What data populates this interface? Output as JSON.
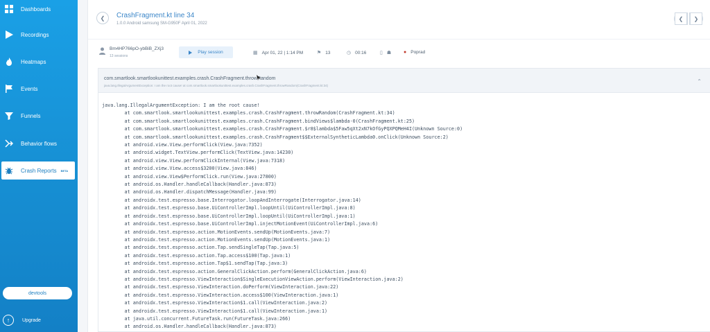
{
  "sidebar": {
    "items": [
      {
        "label": "Dashboards",
        "icon": "dashboards-icon"
      },
      {
        "label": "Recordings",
        "icon": "play-icon"
      },
      {
        "label": "Heatmaps",
        "icon": "flame-icon"
      },
      {
        "label": "Events",
        "icon": "flag-icon"
      },
      {
        "label": "Funnels",
        "icon": "funnel-icon"
      },
      {
        "label": "Behavior flows",
        "icon": "flows-icon"
      },
      {
        "label": "Crash Reports",
        "icon": "bug-icon",
        "active": true,
        "badge": "BETA"
      }
    ],
    "devtools_label": "devtools",
    "upgrade_label": "Upgrade"
  },
  "header": {
    "title": "CrashFragment.kt line 34",
    "subtitle": "1.0.0 Android samsung SM-G950F April 01, 2022"
  },
  "session": {
    "user_id": "Bm4HP766pO-ybBiB_ZXj3",
    "sessions": "13 sessions",
    "play_label": "Play session",
    "datetime": "Apr 01, 22 | 1:14 PM",
    "events": "13",
    "duration": "00:16",
    "location": "Poprad"
  },
  "crash": {
    "name": "com.smartlook.smartlookunittest.examples.crash.CrashFragment.throwRandom",
    "message": "java.lang.IllegalArgumentException: I am the root cause! at com.smartlook.smartlookunittest.examples.crash.CrashFragment.throwRandom(CrashFragment.kt:34)",
    "stacktrace": "java.lang.IllegalArgumentException: I am the root cause!\n        at com.smartlook.smartlookunittest.examples.crash.CrashFragment.throwRandom(CrashFragment.kt:34)\n        at com.smartlook.smartlookunittest.examples.crash.CrashFragment.bindViews$lambda-0(CrashFragment.kt:25)\n        at com.smartlook.smartlookunittest.examples.crash.CrashFragment.$r8$lambda$5Faw5qXt2xN7kOfGyPQXPQMeH4I(Unknown Source:0)\n        at com.smartlook.smartlookunittest.examples.crash.CrashFragment$$ExternalSyntheticLambda0.onClick(Unknown Source:2)\n        at android.view.View.performClick(View.java:7352)\n        at android.widget.TextView.performClick(TextView.java:14230)\n        at android.view.View.performClickInternal(View.java:7318)\n        at android.view.View.access$3200(View.java:846)\n        at android.view.View$PerformClick.run(View.java:27800)\n        at android.os.Handler.handleCallback(Handler.java:873)\n        at android.os.Handler.dispatchMessage(Handler.java:99)\n        at androidx.test.espresso.base.Interrogator.loopAndInterrogate(Interrogator.java:14)\n        at androidx.test.espresso.base.UiControllerImpl.loopUntil(UiControllerImpl.java:8)\n        at androidx.test.espresso.base.UiControllerImpl.loopUntil(UiControllerImpl.java:1)\n        at androidx.test.espresso.base.UiControllerImpl.injectMotionEvent(UiControllerImpl.java:6)\n        at androidx.test.espresso.action.MotionEvents.sendUp(MotionEvents.java:7)\n        at androidx.test.espresso.action.MotionEvents.sendUp(MotionEvents.java:1)\n        at androidx.test.espresso.action.Tap.sendSingleTap(Tap.java:5)\n        at androidx.test.espresso.action.Tap.access$100(Tap.java:1)\n        at androidx.test.espresso.action.Tap$1.sendTap(Tap.java:3)\n        at androidx.test.espresso.action.GeneralClickAction.perform(GeneralClickAction.java:6)\n        at androidx.test.espresso.ViewInteraction$SingleExecutionViewAction.perform(ViewInteraction.java:2)\n        at androidx.test.espresso.ViewInteraction.doPerform(ViewInteraction.java:22)\n        at androidx.test.espresso.ViewInteraction.access$100(ViewInteraction.java:1)\n        at androidx.test.espresso.ViewInteraction$1.call(ViewInteraction.java:2)\n        at androidx.test.espresso.ViewInteraction$1.call(ViewInteraction.java:1)\n        at java.util.concurrent.FutureTask.run(FutureTask.java:266)\n        at android.os.Handler.handleCallback(Handler.java:873)"
  },
  "colors": {
    "sidebar": "#1790d4",
    "accent": "#3b86c8",
    "play_button_bg": "#e7f1fb",
    "crash_header_bg": "#f1f4f8"
  }
}
